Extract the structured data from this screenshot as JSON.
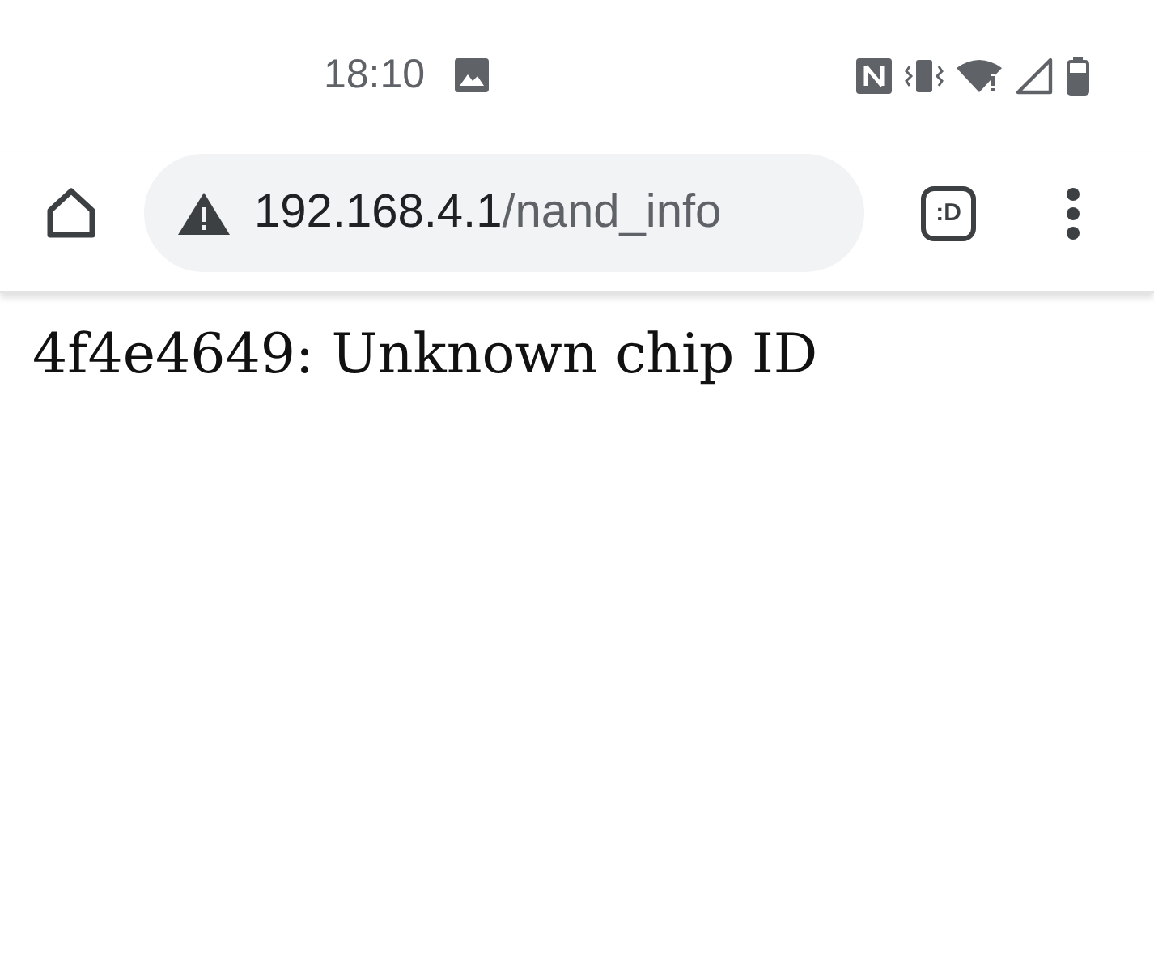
{
  "status_bar": {
    "time": "18:10"
  },
  "address_bar": {
    "host": "192.168.4.1",
    "path": "/nand_info"
  },
  "tab_switcher": {
    "label": ":D"
  },
  "page": {
    "text": "4f4e4649: Unknown chip ID"
  }
}
